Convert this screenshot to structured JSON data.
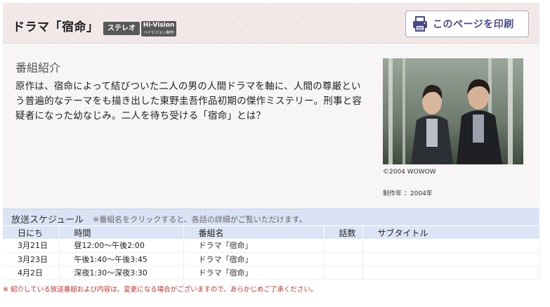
{
  "header": {
    "title": "ドラマ「宿命」",
    "badge_stereo": "ステレオ",
    "badge_hivision_top": "Hi-Vision",
    "badge_hivision_bottom": "ハイビジョン制作",
    "print_label": "このページを印刷"
  },
  "intro": {
    "section_title": "番組紹介",
    "description": "原作は、宿命によって結びついた二人の男の人間ドラマを軸に、人間の尊厳という普遍的なテーマをも描き出した東野圭吾作品初期の傑作ミステリー。刑事と容疑者になった幼なじみ。二人を待ち受ける「宿命」とは？",
    "copyright": "©2004 WOWOW",
    "year_line": "制作年 ：2004年"
  },
  "schedule": {
    "title": "放送スケジュール",
    "note": "※番組名をクリックすると、各話の詳細がご覧いただけます。",
    "columns": [
      "日にち",
      "時間",
      "番組名",
      "話数",
      "サブタイトル"
    ],
    "rows": [
      {
        "date": "3月21日",
        "time": "昼12:00～午後2:00",
        "program": "ドラマ「宿命」",
        "episode": "",
        "subtitle": ""
      },
      {
        "date": "3月23日",
        "time": "午後1:40～午後3:45",
        "program": "ドラマ「宿命」",
        "episode": "",
        "subtitle": ""
      },
      {
        "date": "4月2日",
        "time": "深夜1:30～深夜3:30",
        "program": "ドラマ「宿命」",
        "episode": "",
        "subtitle": ""
      }
    ]
  },
  "footnote": "※ 紹介している放送番組および内容は、変更になる場合がございますので、あらかじめご了承ください。",
  "colors": {
    "accent": "#4a4a8a",
    "schedule_bg": "#d9e3f4",
    "footnote": "#c0302a"
  }
}
